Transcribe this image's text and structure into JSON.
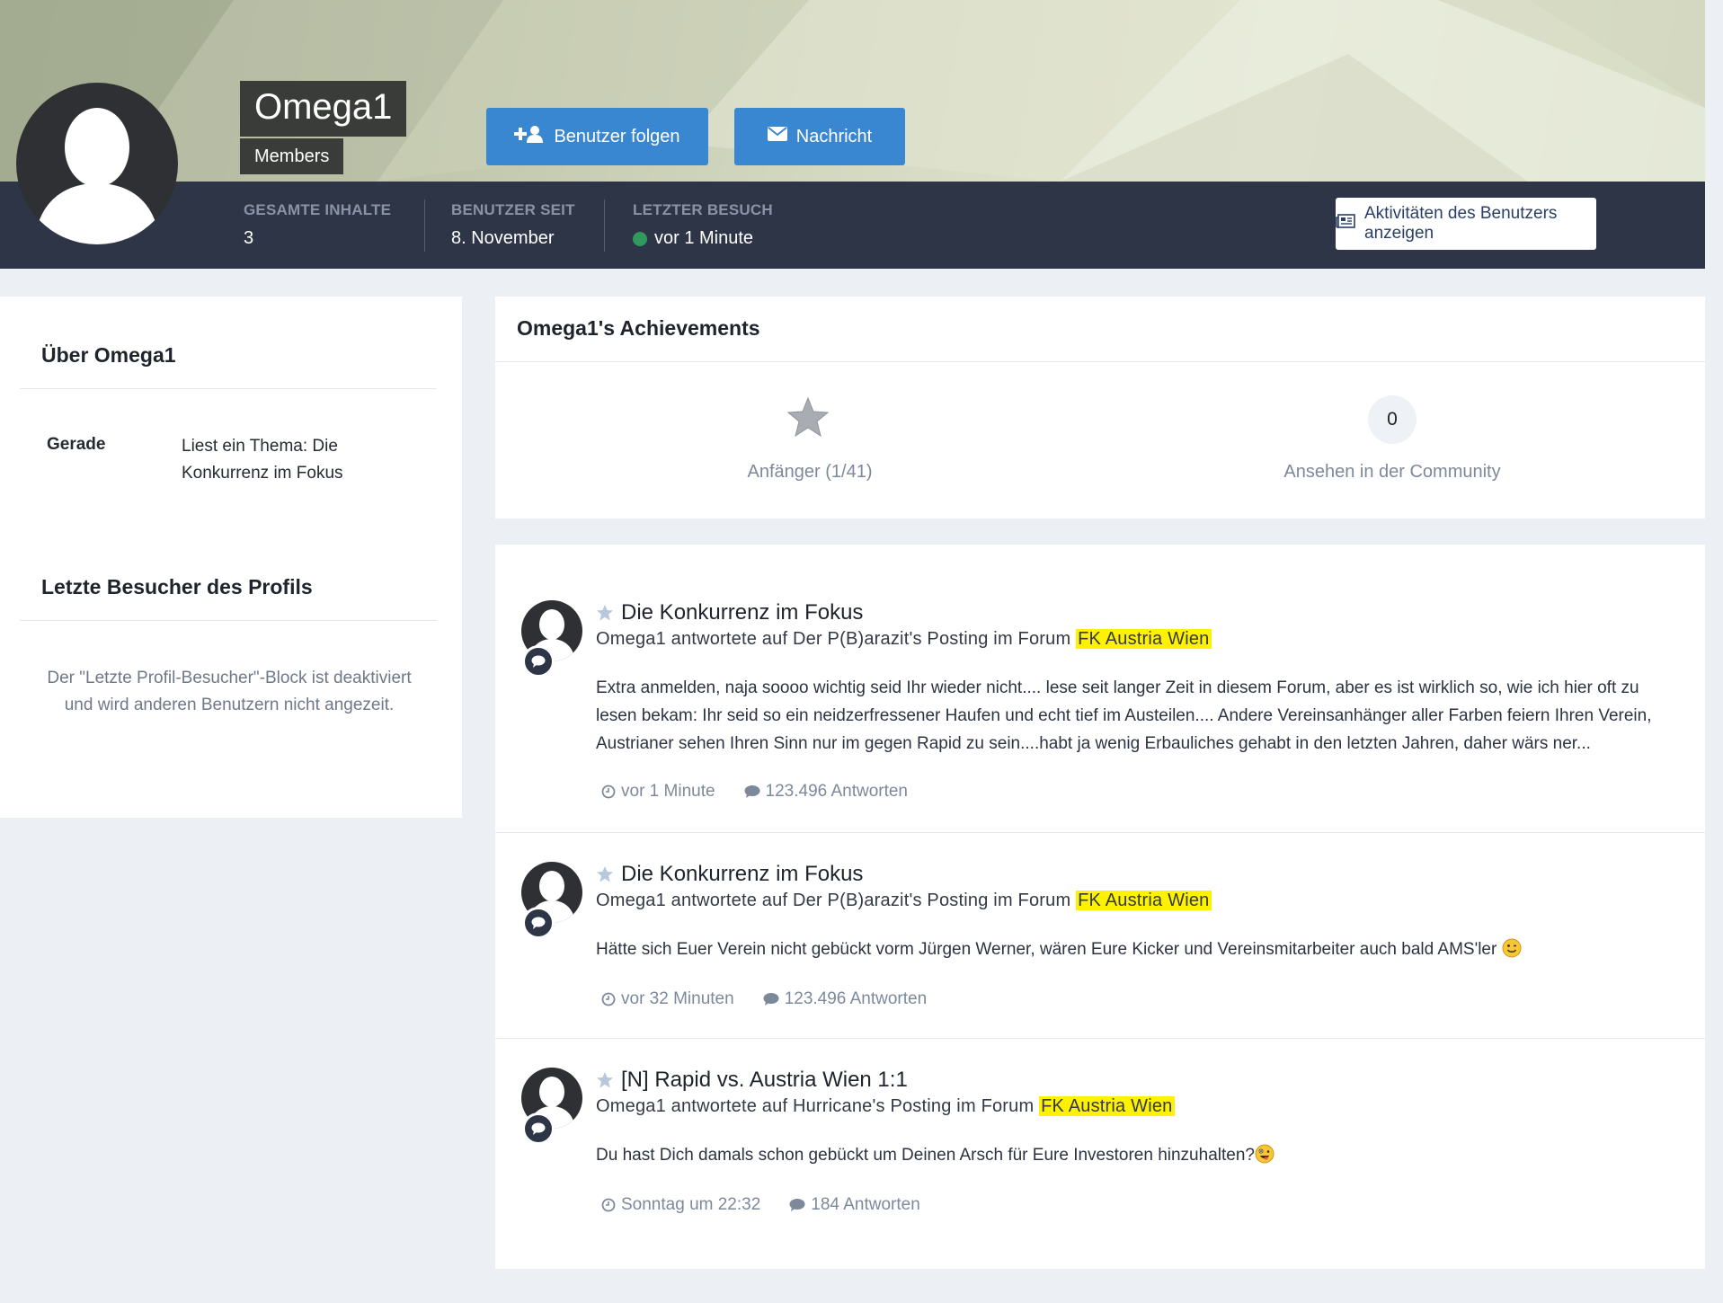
{
  "profile": {
    "username": "Omega1",
    "group": "Members",
    "follow_label": "Benutzer folgen",
    "message_label": "Nachricht",
    "activity_button_label": "Aktivitäten des Benutzers anzeigen"
  },
  "stats": [
    {
      "label": "GESAMTE INHALTE",
      "value": "3"
    },
    {
      "label": "BENUTZER SEIT",
      "value": "8. November"
    },
    {
      "label": "LETZTER BESUCH",
      "value": "vor 1 Minute"
    }
  ],
  "sidebar": {
    "about_title": "Über Omega1",
    "status_key": "Gerade",
    "status_value": "Liest ein Thema: Die Konkurrenz im Fokus",
    "visitors_title": "Letzte Besucher des Profils",
    "visitors_note": "Der \"Letzte Profil-Besucher\"-Block ist deaktiviert und wird anderen Benutzern nicht angezeit."
  },
  "achievements": {
    "title": "Omega1's Achievements",
    "rank_label": "Anfänger (1/41)",
    "reputation_value": "0",
    "reputation_label": "Ansehen in der Community"
  },
  "activity": [
    {
      "title": "Die Konkurrenz im Fokus",
      "sub_prefix": "Omega1 antwortete auf Der P(B)arazit's Posting im Forum ",
      "forum": "FK Austria Wien",
      "body": "Extra anmelden, naja soooo wichtig seid Ihr wieder nicht.... lese seit langer Zeit in diesem Forum, aber es ist wirklich so, wie ich hier oft zu lesen bekam: Ihr seid so ein neidzerfressener Haufen und echt tief im Austeilen.... Andere Vereinsanhänger aller Farben feiern Ihren Verein, Austrianer sehen Ihren Sinn nur im gegen Rapid zu sein....habt ja wenig Erbauliches gehabt in den letzten Jahren, daher wärs ner...",
      "time": "vor 1 Minute",
      "replies": "123.496 Antworten"
    },
    {
      "title": "Die Konkurrenz im Fokus",
      "sub_prefix": "Omega1 antwortete auf Der P(B)arazit's Posting im Forum ",
      "forum": "FK Austria Wien",
      "body": "Hätte sich Euer Verein nicht gebückt vorm Jürgen Werner, wären Eure Kicker und Vereinsmitarbeiter auch bald AMS'ler",
      "time": "vor 32 Minuten",
      "replies": "123.496 Antworten"
    },
    {
      "title": "[N] Rapid vs. Austria Wien 1:1",
      "sub_prefix": "Omega1 antwortete auf Hurricane's Posting im Forum ",
      "forum": "FK Austria Wien",
      "body": "Du hast Dich damals schon gebückt um Deinen Arsch für Eure Investoren hinzuhalten?",
      "time": "Sonntag um 22:32",
      "replies": "184 Antworten"
    }
  ],
  "colors": {
    "accent_blue": "#3a87d1",
    "stats_bar": "#2e3547",
    "highlight": "#fff200",
    "online": "#2e9a5e"
  }
}
